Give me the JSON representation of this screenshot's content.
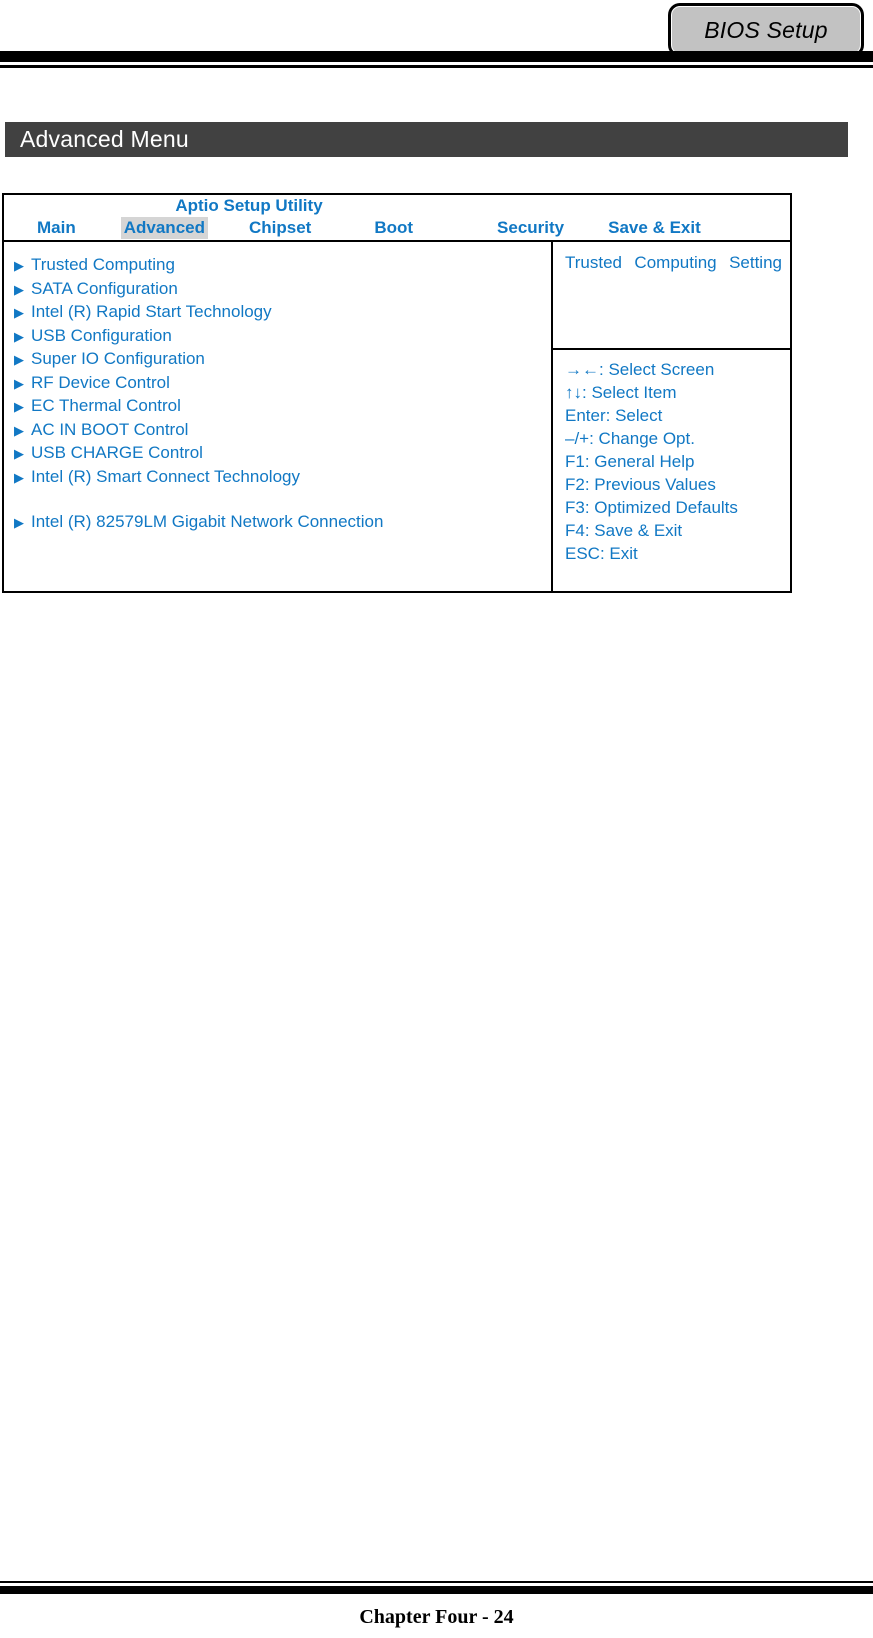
{
  "header": {
    "bios_tab_label": "BIOS Setup"
  },
  "page": {
    "menu_title": "Advanced Menu",
    "footer": "Chapter Four - 24"
  },
  "bios": {
    "utility_title": "Aptio Setup Utility",
    "tabs": [
      {
        "label": "Main",
        "active": false
      },
      {
        "label": "Advanced",
        "active": true
      },
      {
        "label": "Chipset",
        "active": false
      },
      {
        "label": "Boot",
        "active": false
      },
      {
        "label": "Security",
        "active": false
      },
      {
        "label": "Save & Exit",
        "active": false
      }
    ],
    "arrow_glyph": "▶",
    "menu_items": [
      "Trusted Computing",
      "SATA Configuration",
      "Intel (R) Rapid Start Technology",
      "USB Configuration",
      "Super IO Configuration",
      "RF Device Control",
      "EC Thermal Control",
      "AC IN BOOT Control",
      "USB CHARGE Control",
      "Intel (R) Smart Connect Technology"
    ],
    "menu_items_after_gap": [
      "Intel (R) 82579LM Gigabit Network Connection"
    ],
    "help_description": "Trusted Computing Setting",
    "help_keys": [
      "→←: Select Screen",
      "↑↓: Select Item",
      "Enter: Select",
      "–/+: Change Opt.",
      "F1: General Help",
      "F2: Previous Values",
      "F3: Optimized Defaults",
      "F4: Save & Exit",
      "ESC: Exit"
    ]
  },
  "colors": {
    "bios_blue": "#1178c4",
    "title_bar": "#414141",
    "tab_highlight": "#d5d5d5",
    "bios_tab_fill": "#c2c2c2"
  }
}
